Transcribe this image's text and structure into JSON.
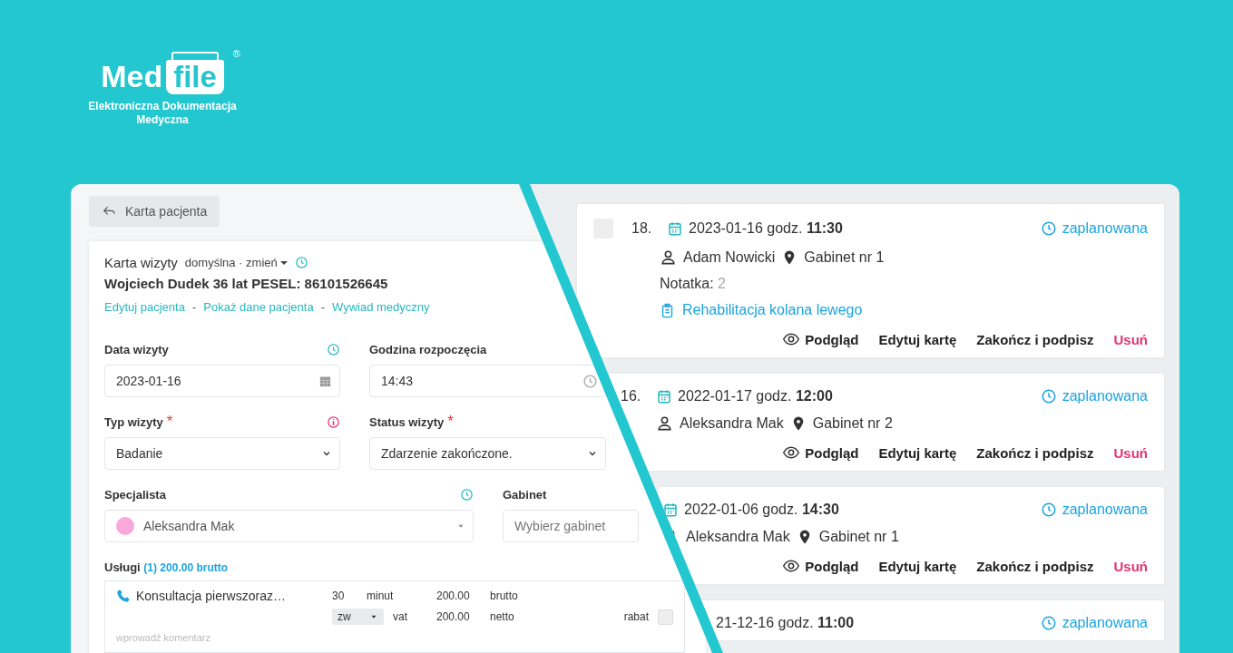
{
  "logo": {
    "word_1": "Med",
    "word_2": "file",
    "mark": "®",
    "tagline": "Elektroniczna Dokumentacja Medyczna"
  },
  "back_button": {
    "label": "Karta pacjenta"
  },
  "visit_card": {
    "title": "Karta wizyty",
    "template": "domyślna · zmień",
    "patient": "Wojciech Dudek 36 lat PESEL: 86101526645",
    "link_separator": "-",
    "links": [
      "Edytuj pacjenta",
      "Pokaż dane pacjenta",
      "Wywiad medyczny"
    ],
    "fields": [
      {
        "kind": "date",
        "label": "Data wizyty",
        "history": true,
        "value": "2023-01-16"
      },
      {
        "kind": "time",
        "label": "Godzina rozpoczęcia",
        "value": "14:43"
      },
      {
        "kind": "select",
        "label": "Typ wizyty",
        "required_mark": "*",
        "info": true,
        "value": "Badanie"
      },
      {
        "kind": "select",
        "label": "Status wizyty",
        "required_mark": "*",
        "value": "Zdarzenie zakończone."
      },
      {
        "kind": "person",
        "label": "Specjalista",
        "history": true,
        "value": "Aleksandra Mak",
        "color": "#f9a8dc"
      },
      {
        "kind": "placeholder",
        "label": "Gabinet",
        "placeholder": "Wybierz gabinet"
      }
    ],
    "services": {
      "label": "Usługi",
      "summary": "(1) 200.00 brutto",
      "items": [
        {
          "name": "Konsultacja pierwszoraz…",
          "duration": "30",
          "duration_unit": "minut",
          "gross": "200.00",
          "gross_label": "brutto",
          "vat": "zw",
          "vat_label": "vat",
          "net": "200.00",
          "net_label": "netto",
          "discount_label": "rabat",
          "discount": false,
          "comment_placeholder": "wprowadź komentarz"
        }
      ]
    }
  },
  "visits": [
    {
      "kind": "full",
      "selected": false,
      "number": "18.",
      "date": "2023-01-16 godz.",
      "time": "11:30",
      "status": "zaplanowana",
      "doctor": "Adam Nowicki",
      "room": "Gabinet nr 1",
      "note_label": "Notatka:",
      "note_count": "2",
      "plan": "Rehabilitacja kolana lewego",
      "actions": [
        {
          "kind": "preview",
          "label": "Podgląd"
        },
        {
          "kind": "edit",
          "label": "Edytuj kartę"
        },
        {
          "kind": "edit",
          "label": "Zakończ i podpisz"
        },
        {
          "kind": "delete",
          "label": "Usuń"
        }
      ]
    },
    {
      "kind": "numbered",
      "number": "16.",
      "date": "2022-01-17 godz.",
      "time": "12:00",
      "status": "zaplanowana",
      "doctor": "Aleksandra Mak",
      "room": "Gabinet nr 2",
      "actions": [
        {
          "kind": "preview",
          "label": "Podgląd"
        },
        {
          "kind": "edit",
          "label": "Edytuj kartę"
        },
        {
          "kind": "edit",
          "label": "Zakończ i podpisz"
        },
        {
          "kind": "delete",
          "label": "Usuń"
        }
      ]
    },
    {
      "kind": "partial",
      "date": "2022-01-06 godz.",
      "time": "14:30",
      "status": "zaplanowana",
      "doctor": "Aleksandra Mak",
      "room": "Gabinet nr 1",
      "actions": [
        {
          "kind": "preview",
          "label": "Podgląd"
        },
        {
          "kind": "edit",
          "label": "Edytuj kartę"
        },
        {
          "kind": "edit",
          "label": "Zakończ i podpisz"
        },
        {
          "kind": "delete",
          "label": "Usuń"
        }
      ]
    },
    {
      "kind": "cut",
      "date": "21-12-16 godz.",
      "time": "11:00",
      "status": "zaplanowana"
    }
  ]
}
